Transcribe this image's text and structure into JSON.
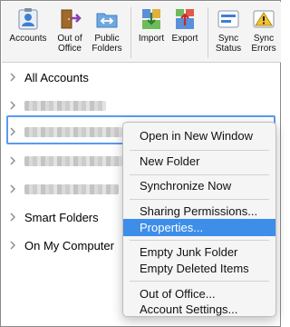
{
  "toolbar": {
    "buttons": [
      {
        "label": "Accounts",
        "icon": "accounts-icon"
      },
      {
        "label": "Out of\nOffice",
        "icon": "out-of-office-icon"
      },
      {
        "label": "Public\nFolders",
        "icon": "public-folders-icon"
      },
      {
        "label": "Import",
        "icon": "import-icon"
      },
      {
        "label": "Export",
        "icon": "export-icon"
      },
      {
        "label": "Sync\nStatus",
        "icon": "sync-status-icon"
      },
      {
        "label": "Sync\nErrors",
        "icon": "sync-errors-icon"
      }
    ]
  },
  "tree": {
    "items": [
      {
        "label": "All Accounts"
      },
      {
        "label": ""
      },
      {
        "label": ""
      },
      {
        "label": ""
      },
      {
        "label": ""
      },
      {
        "label": "Smart Folders"
      },
      {
        "label": "On My Computer"
      }
    ]
  },
  "context_menu": {
    "items": [
      {
        "label": "Open in New Window"
      },
      {
        "label": "New Folder"
      },
      {
        "label": "Synchronize Now"
      },
      {
        "label": "Sharing Permissions..."
      },
      {
        "label": "Properties...",
        "highlighted": true
      },
      {
        "label": "Empty Junk Folder"
      },
      {
        "label": "Empty Deleted Items"
      },
      {
        "label": "Out of Office..."
      },
      {
        "label": "Account Settings..."
      }
    ]
  },
  "colors": {
    "highlight": "#3d8ee9",
    "selection_outline": "#5a9af0"
  }
}
